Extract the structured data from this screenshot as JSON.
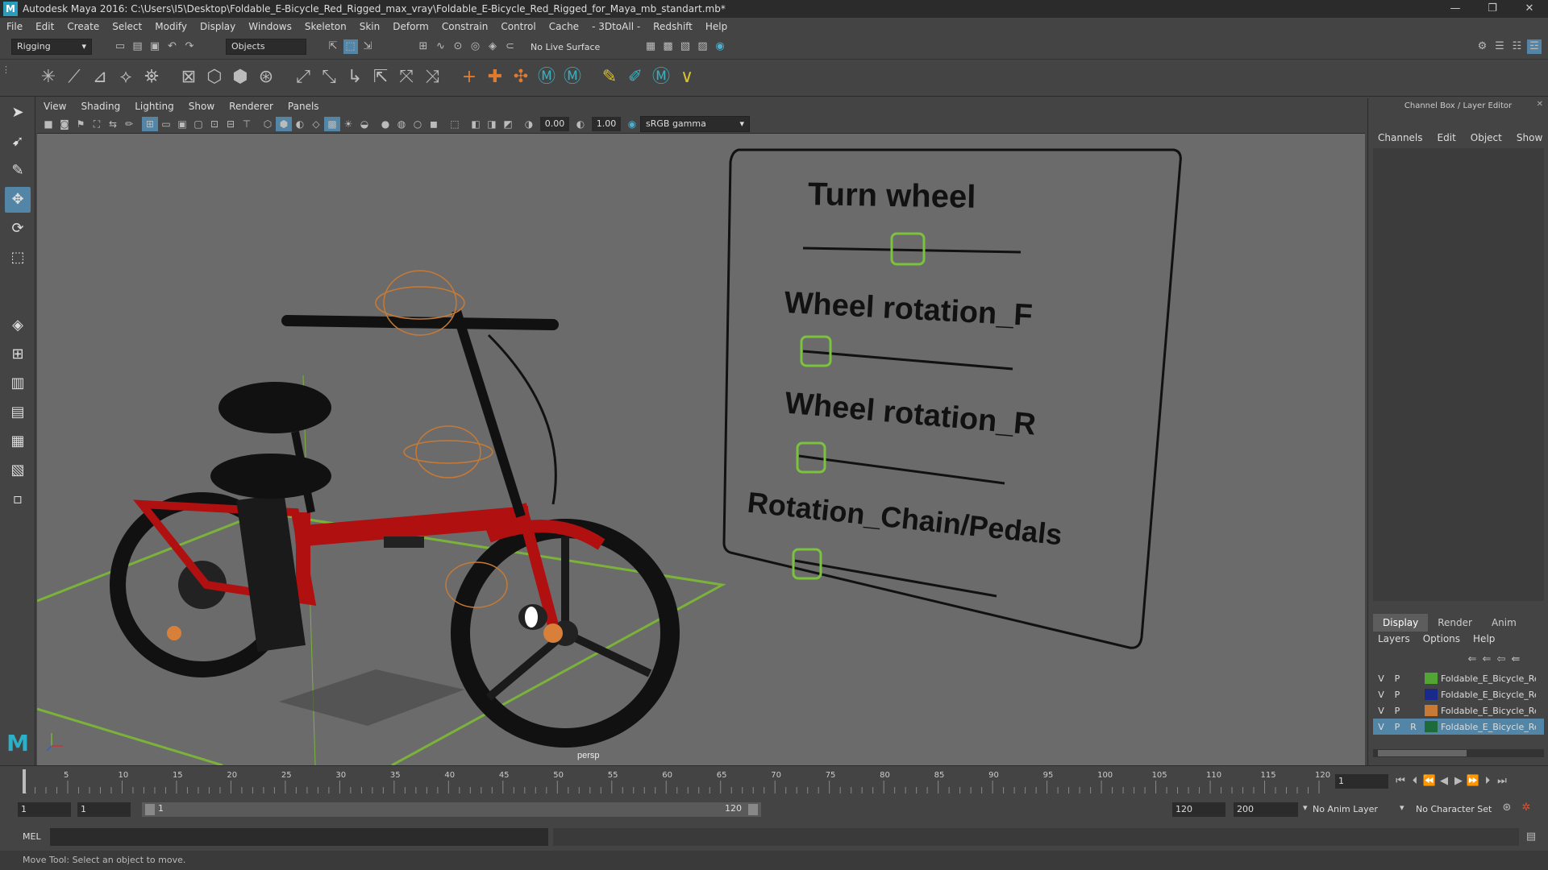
{
  "window": {
    "title": "Autodesk Maya 2016: C:\\Users\\I5\\Desktop\\Foldable_E-Bicycle_Red_Rigged_max_vray\\Foldable_E-Bicycle_Red_Rigged_for_Maya_mb_standart.mb*",
    "controls": [
      "—",
      "❐",
      "✕"
    ]
  },
  "menubar": [
    "File",
    "Edit",
    "Create",
    "Select",
    "Modify",
    "Display",
    "Windows",
    "Skeleton",
    "Skin",
    "Deform",
    "Constrain",
    "Control",
    "Cache",
    "- 3DtoAll -",
    "Redshift",
    "Help"
  ],
  "statusline": {
    "mode": "Rigging",
    "selection_mode": "Objects",
    "live_surface": "No Live Surface"
  },
  "viewport": {
    "menu": [
      "View",
      "Shading",
      "Lighting",
      "Show",
      "Renderer",
      "Panels"
    ],
    "exposure": "0.00",
    "gamma": "1.00",
    "color_space": "sRGB gamma",
    "camera_label": "persp"
  },
  "control_board": {
    "items": [
      {
        "label": "Turn wheel",
        "slider_value": 0.5
      },
      {
        "label": "Wheel rotation_F",
        "slider_value": 0.0
      },
      {
        "label": "Wheel rotation_R",
        "slider_value": 0.0
      },
      {
        "label": "Rotation_Chain/Pedals",
        "slider_value": 0.0
      }
    ]
  },
  "channel_box": {
    "title": "Channel Box / Layer Editor",
    "menu": [
      "Channels",
      "Edit",
      "Object",
      "Show"
    ],
    "tabs": [
      "Display",
      "Render",
      "Anim"
    ],
    "layer_menu": [
      "Layers",
      "Options",
      "Help"
    ],
    "layers": [
      {
        "v": "V",
        "p": "P",
        "r": "",
        "color": "#52a535",
        "name": "Foldable_E_Bicycle_Red"
      },
      {
        "v": "V",
        "p": "P",
        "r": "",
        "color": "#1a2a8a",
        "name": "Foldable_E_Bicycle_Red"
      },
      {
        "v": "V",
        "p": "P",
        "r": "",
        "color": "#c77a35",
        "name": "Foldable_E_Bicycle_Red"
      },
      {
        "v": "V",
        "p": "P",
        "r": "R",
        "color": "#1d6b3a",
        "name": "Foldable_E_Bicycle_Red"
      }
    ]
  },
  "timeline": {
    "ticks": [
      "5",
      "10",
      "15",
      "20",
      "25",
      "30",
      "35",
      "40",
      "45",
      "50",
      "55",
      "60",
      "65",
      "70",
      "75",
      "80",
      "85",
      "90",
      "95",
      "100",
      "105",
      "110",
      "115",
      "120"
    ],
    "start_tick": "1",
    "current_frame": "1"
  },
  "range": {
    "start": "1",
    "playback_start": "1",
    "slider_start": "1",
    "slider_end": "120",
    "playback_end": "120",
    "end": "200",
    "anim_layer": "No Anim Layer",
    "character_set": "No Character Set"
  },
  "mel": {
    "label": "MEL"
  },
  "help_line": "Move Tool: Select an object to move.",
  "colors": {
    "accent": "#5285a6",
    "slider_handle": "#7bc23f",
    "bike_red": "#b01010"
  }
}
